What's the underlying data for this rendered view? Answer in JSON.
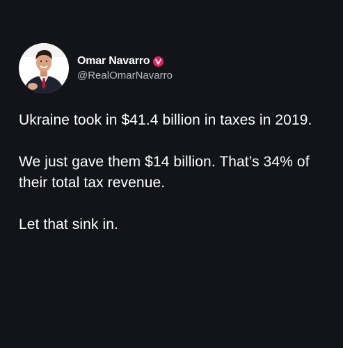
{
  "colors": {
    "background": "#131419",
    "text": "#ffffff",
    "handle": "#b7bcc2",
    "badge": "#e0245e"
  },
  "author": {
    "display_name": "Omar Navarro",
    "handle": "@RealOmarNavarro",
    "avatar_icon": "profile-photo",
    "badge_icon": "verified-badge-icon",
    "badge_glyph": "v"
  },
  "tweet": {
    "paragraphs": [
      "Ukraine took in $41.4 billion in taxes in 2019.",
      "We just gave them $14 billion. That’s 34% of their total tax revenue.",
      "Let that sink in."
    ]
  }
}
